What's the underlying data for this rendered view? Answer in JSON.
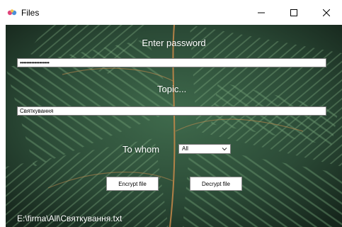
{
  "window": {
    "title": "Files",
    "controls": {
      "minimize_icon": "minimize-icon",
      "maximize_icon": "maximize-icon",
      "close_icon": "close-icon"
    }
  },
  "form": {
    "password_label": "Enter password",
    "password_value": "••••••••••••••••••",
    "topic_label": "Topic...",
    "topic_value": "Святкування",
    "recipient_label": "To whom",
    "recipient_selected": "All",
    "encrypt_label": "Encrypt file",
    "decrypt_label": "Decrypt file",
    "file_path": "E:\\firma\\All\\Святкування.txt"
  },
  "colors": {
    "background_fern": "#25402e",
    "label_text": "#ffffff"
  }
}
